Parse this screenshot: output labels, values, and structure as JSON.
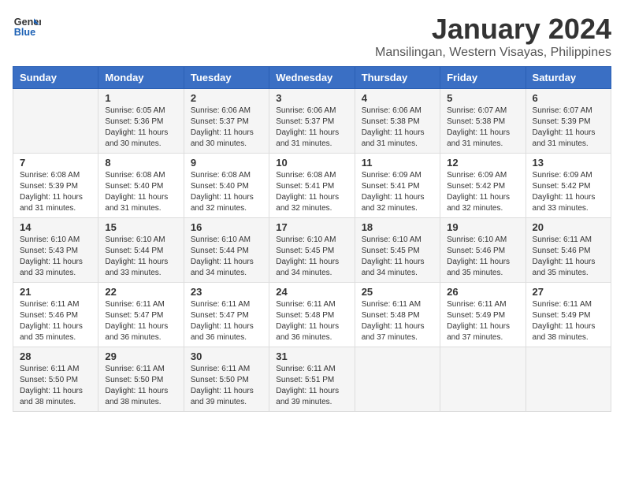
{
  "logo": {
    "line1": "General",
    "line2": "Blue"
  },
  "title": "January 2024",
  "subtitle": "Mansilingan, Western Visayas, Philippines",
  "weekdays": [
    "Sunday",
    "Monday",
    "Tuesday",
    "Wednesday",
    "Thursday",
    "Friday",
    "Saturday"
  ],
  "weeks": [
    [
      {
        "day": "",
        "info": ""
      },
      {
        "day": "1",
        "info": "Sunrise: 6:05 AM\nSunset: 5:36 PM\nDaylight: 11 hours\nand 30 minutes."
      },
      {
        "day": "2",
        "info": "Sunrise: 6:06 AM\nSunset: 5:37 PM\nDaylight: 11 hours\nand 30 minutes."
      },
      {
        "day": "3",
        "info": "Sunrise: 6:06 AM\nSunset: 5:37 PM\nDaylight: 11 hours\nand 31 minutes."
      },
      {
        "day": "4",
        "info": "Sunrise: 6:06 AM\nSunset: 5:38 PM\nDaylight: 11 hours\nand 31 minutes."
      },
      {
        "day": "5",
        "info": "Sunrise: 6:07 AM\nSunset: 5:38 PM\nDaylight: 11 hours\nand 31 minutes."
      },
      {
        "day": "6",
        "info": "Sunrise: 6:07 AM\nSunset: 5:39 PM\nDaylight: 11 hours\nand 31 minutes."
      }
    ],
    [
      {
        "day": "7",
        "info": "Sunrise: 6:08 AM\nSunset: 5:39 PM\nDaylight: 11 hours\nand 31 minutes."
      },
      {
        "day": "8",
        "info": "Sunrise: 6:08 AM\nSunset: 5:40 PM\nDaylight: 11 hours\nand 31 minutes."
      },
      {
        "day": "9",
        "info": "Sunrise: 6:08 AM\nSunset: 5:40 PM\nDaylight: 11 hours\nand 32 minutes."
      },
      {
        "day": "10",
        "info": "Sunrise: 6:08 AM\nSunset: 5:41 PM\nDaylight: 11 hours\nand 32 minutes."
      },
      {
        "day": "11",
        "info": "Sunrise: 6:09 AM\nSunset: 5:41 PM\nDaylight: 11 hours\nand 32 minutes."
      },
      {
        "day": "12",
        "info": "Sunrise: 6:09 AM\nSunset: 5:42 PM\nDaylight: 11 hours\nand 32 minutes."
      },
      {
        "day": "13",
        "info": "Sunrise: 6:09 AM\nSunset: 5:42 PM\nDaylight: 11 hours\nand 33 minutes."
      }
    ],
    [
      {
        "day": "14",
        "info": "Sunrise: 6:10 AM\nSunset: 5:43 PM\nDaylight: 11 hours\nand 33 minutes."
      },
      {
        "day": "15",
        "info": "Sunrise: 6:10 AM\nSunset: 5:44 PM\nDaylight: 11 hours\nand 33 minutes."
      },
      {
        "day": "16",
        "info": "Sunrise: 6:10 AM\nSunset: 5:44 PM\nDaylight: 11 hours\nand 34 minutes."
      },
      {
        "day": "17",
        "info": "Sunrise: 6:10 AM\nSunset: 5:45 PM\nDaylight: 11 hours\nand 34 minutes."
      },
      {
        "day": "18",
        "info": "Sunrise: 6:10 AM\nSunset: 5:45 PM\nDaylight: 11 hours\nand 34 minutes."
      },
      {
        "day": "19",
        "info": "Sunrise: 6:10 AM\nSunset: 5:46 PM\nDaylight: 11 hours\nand 35 minutes."
      },
      {
        "day": "20",
        "info": "Sunrise: 6:11 AM\nSunset: 5:46 PM\nDaylight: 11 hours\nand 35 minutes."
      }
    ],
    [
      {
        "day": "21",
        "info": "Sunrise: 6:11 AM\nSunset: 5:46 PM\nDaylight: 11 hours\nand 35 minutes."
      },
      {
        "day": "22",
        "info": "Sunrise: 6:11 AM\nSunset: 5:47 PM\nDaylight: 11 hours\nand 36 minutes."
      },
      {
        "day": "23",
        "info": "Sunrise: 6:11 AM\nSunset: 5:47 PM\nDaylight: 11 hours\nand 36 minutes."
      },
      {
        "day": "24",
        "info": "Sunrise: 6:11 AM\nSunset: 5:48 PM\nDaylight: 11 hours\nand 36 minutes."
      },
      {
        "day": "25",
        "info": "Sunrise: 6:11 AM\nSunset: 5:48 PM\nDaylight: 11 hours\nand 37 minutes."
      },
      {
        "day": "26",
        "info": "Sunrise: 6:11 AM\nSunset: 5:49 PM\nDaylight: 11 hours\nand 37 minutes."
      },
      {
        "day": "27",
        "info": "Sunrise: 6:11 AM\nSunset: 5:49 PM\nDaylight: 11 hours\nand 38 minutes."
      }
    ],
    [
      {
        "day": "28",
        "info": "Sunrise: 6:11 AM\nSunset: 5:50 PM\nDaylight: 11 hours\nand 38 minutes."
      },
      {
        "day": "29",
        "info": "Sunrise: 6:11 AM\nSunset: 5:50 PM\nDaylight: 11 hours\nand 38 minutes."
      },
      {
        "day": "30",
        "info": "Sunrise: 6:11 AM\nSunset: 5:50 PM\nDaylight: 11 hours\nand 39 minutes."
      },
      {
        "day": "31",
        "info": "Sunrise: 6:11 AM\nSunset: 5:51 PM\nDaylight: 11 hours\nand 39 minutes."
      },
      {
        "day": "",
        "info": ""
      },
      {
        "day": "",
        "info": ""
      },
      {
        "day": "",
        "info": ""
      }
    ]
  ],
  "colors": {
    "header_bg": "#3a6fc4",
    "header_text": "#ffffff"
  }
}
